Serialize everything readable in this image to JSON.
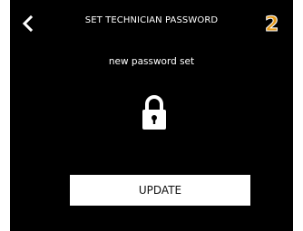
{
  "header": {
    "title": "SET TECHNICIAN PASSWORD",
    "step_number": "2",
    "back_icon": "chevron-left-icon"
  },
  "main": {
    "status_text": "new password set",
    "lock_icon": "lock-icon"
  },
  "actions": {
    "update_label": "UPDATE"
  },
  "colors": {
    "background": "#000000",
    "text": "#ffffff",
    "accent": "#e69a19",
    "button_bg": "#ffffff",
    "button_text": "#111111"
  }
}
